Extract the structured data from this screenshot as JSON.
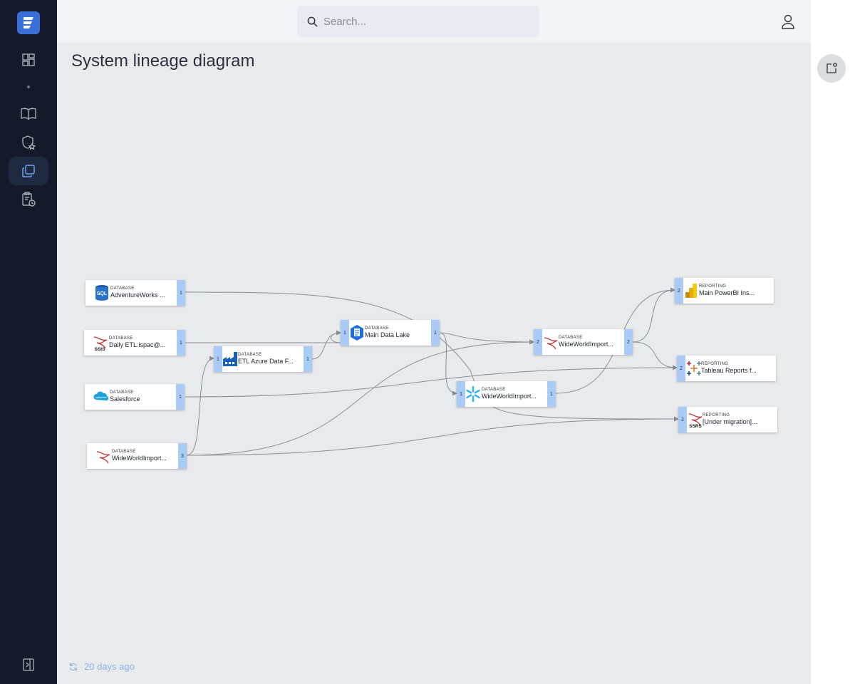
{
  "header": {
    "search_placeholder": "Search..."
  },
  "page": {
    "title": "System lineage diagram",
    "refreshed": "20 days ago"
  },
  "nodes": {
    "adventureworks": {
      "type": "DATABASE",
      "label": "AdventureWorks ...",
      "port_out": "1",
      "icon": "sql-database-icon"
    },
    "daily_etl": {
      "type": "DATABASE",
      "label": "Daily ETL.ispac@...",
      "port_out": "1",
      "icon": "ssis-icon"
    },
    "salesforce": {
      "type": "DATABASE",
      "label": "Salesforce",
      "port_out": "1",
      "icon": "salesforce-icon"
    },
    "wwi_source": {
      "type": "DATABASE",
      "label": "WideWorldImport...",
      "port_out": "3",
      "icon": "sql-server-icon"
    },
    "etl_azure": {
      "type": "DATABASE",
      "label": "ETL Azure Data F...",
      "port_in": "1",
      "port_out": "1",
      "icon": "azure-data-factory-icon"
    },
    "data_lake": {
      "type": "DATABASE",
      "label": "Main Data Lake",
      "port_in": "1",
      "port_out": "1",
      "icon": "data-lake-icon"
    },
    "wwi_sqlserver": {
      "type": "DATABASE",
      "label": "WideWorldImport...",
      "port_in": "2",
      "port_out": "2",
      "icon": "sql-server-icon"
    },
    "wwi_snowflake": {
      "type": "DATABASE",
      "label": "WideWorldImport...",
      "port_in": "1",
      "port_out": "1",
      "icon": "snowflake-icon"
    },
    "powerbi": {
      "type": "REPORTING",
      "label": "Main PowerBI Ins...",
      "port_in": "2",
      "icon": "powerbi-icon"
    },
    "tableau": {
      "type": "REPORTING",
      "label": "Tableau Reports f...",
      "port_in": "2",
      "icon": "tableau-icon"
    },
    "ssrs": {
      "type": "REPORTING",
      "label": "[Under migration]...",
      "port_in": "2",
      "icon": "ssrs-icon"
    }
  },
  "colors": {
    "sidebar": "#141a2a",
    "accent": "#3a6fd8",
    "port": "#a9cbf5",
    "edge": "#8a8d93"
  }
}
